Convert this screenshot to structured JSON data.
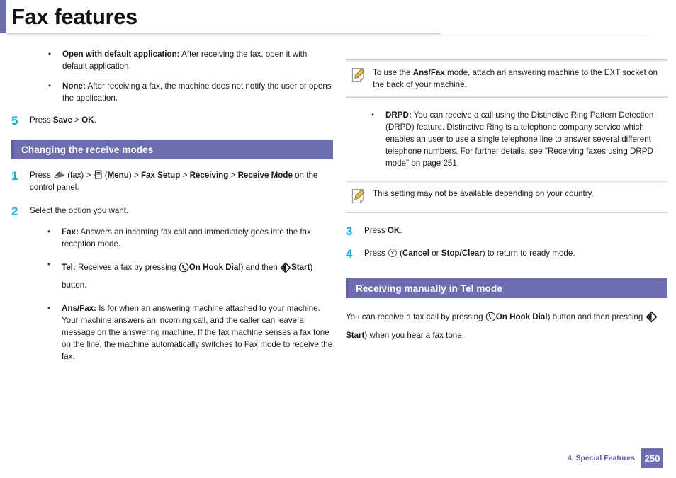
{
  "header": {
    "title": "Fax features"
  },
  "left_column": {
    "bullets_top": [
      {
        "term": "Open with default application:",
        "text": " After receiving the fax, open it with default application."
      },
      {
        "term": "None:",
        "text": "  After receiving a fax, the machine does not notify the user or opens the application."
      }
    ],
    "step5": {
      "num": "5",
      "pre": "Press ",
      "bold1": "Save",
      "mid": " > ",
      "bold2": "OK",
      "post": "."
    },
    "section": {
      "label": "Changing the receive modes"
    },
    "step1": {
      "num": "1",
      "t1": "Press ",
      "fax_label": " (fax) > ",
      "menu_label": " (",
      "menu_bold": "Menu",
      "t2": ") > ",
      "b_fax_setup": "Fax Setup",
      "sep1": " > ",
      "b_receiving": "Receiving",
      "sep2": " > ",
      "b_receive_mode": "Receive Mode",
      "t3": " on the control panel."
    },
    "step2": {
      "num": "2",
      "text": "Select the option you want."
    },
    "mode_bullets": [
      {
        "term": "Fax:",
        "text": " Answers an incoming fax call and immediately goes into the fax reception mode."
      },
      {
        "term": "Tel:",
        "text": " Receives a fax by pressing ",
        "bold_a": "On Hook Dial",
        "text2": ") and then ",
        "bold_b": "Start",
        "text3": ") button."
      },
      {
        "term": "Ans/Fax:",
        "text": " Is for when an answering machine attached to your machine. Your machine answers an incoming call, and the caller can leave a message on the answering machine. If the fax machine senses a fax tone on the line, the machine automatically switches to Fax mode to receive the fax."
      }
    ]
  },
  "right_column": {
    "note1": {
      "pre": "To use the ",
      "bold": "Ans/Fax",
      "post": " mode, attach an answering machine to the EXT socket on the back of your machine."
    },
    "drpd_bullet": {
      "term": "DRPD:",
      "text": " You can receive a call using the Distinctive Ring Pattern Detection (DRPD) feature. Distinctive Ring is a telephone company service which enables an user to use a single telephone line to answer several different telephone numbers. For further details, see \"Receiving faxes using DRPD mode\" on page 251."
    },
    "note2": {
      "text": "This setting may not be available depending on your country."
    },
    "step3": {
      "num": "3",
      "pre": "Press ",
      "bold": "OK",
      "post": "."
    },
    "step4": {
      "num": "4",
      "pre": "Press ",
      "mid": " (",
      "bold1": "Cancel",
      "mid2": " or ",
      "bold2": "Stop/Clear",
      "post": ") to return to ready mode."
    },
    "section": {
      "label": "Receiving manually in Tel mode"
    },
    "manual_para": {
      "t1": "You can receive a fax call by pressing ",
      "b1": "On Hook Dial",
      "t2": ") button and then pressing ",
      "b2": "Start",
      "t3": ") when you hear a fax tone."
    }
  },
  "footer": {
    "chapter": "4.  Special Features",
    "page": "250"
  },
  "icons": {
    "fax": "fax-machine-icon",
    "menu": "menu-list-icon",
    "on_hook_dial": "on-hook-dial-icon",
    "start": "start-diamond-icon",
    "cancel": "cancel-circle-x-icon",
    "note": "note-pencil-icon"
  },
  "colors": {
    "accent_purple": "#6d6db2",
    "step_cyan": "#00b5e8",
    "footer_purple": "#5f5fa5"
  }
}
